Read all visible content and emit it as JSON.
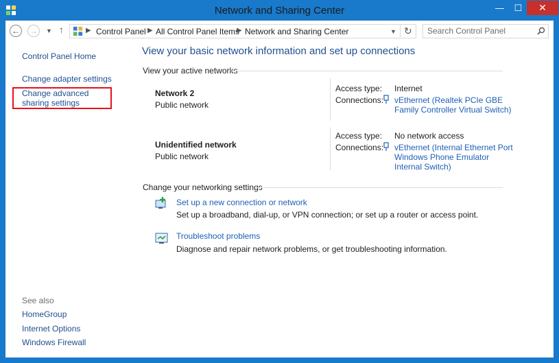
{
  "window": {
    "title": "Network and Sharing Center",
    "controls": {
      "minimize": "—",
      "maximize": "☐",
      "close": "✕"
    }
  },
  "toolbar": {
    "back_icon": "back-arrow-icon",
    "forward_icon": "forward-arrow-icon",
    "recent_icon": "chevron-down-icon",
    "up_icon": "up-arrow-icon",
    "breadcrumb": [
      "Control Panel",
      "All Control Panel Items",
      "Network and Sharing Center"
    ],
    "search_placeholder": "Search Control Panel"
  },
  "sidebar": {
    "home": "Control Panel Home",
    "items": [
      "Change adapter settings",
      "Change advanced sharing settings"
    ],
    "see_also_label": "See also",
    "see_also": [
      "HomeGroup",
      "Internet Options",
      "Windows Firewall"
    ]
  },
  "main": {
    "heading": "View your basic network information and set up connections",
    "active_label": "View your active networks",
    "networks": [
      {
        "name": "Network  2",
        "type": "Public network",
        "access_label": "Access type:",
        "access_value": "Internet",
        "connections_label": "Connections:",
        "connection_lines": [
          "vEthernet (Realtek PCIe GBE",
          "Family Controller Virtual Switch)"
        ]
      },
      {
        "name": "Unidentified network",
        "type": "Public network",
        "access_label": "Access type:",
        "access_value": "No network access",
        "connections_label": "Connections:",
        "connection_lines": [
          "vEthernet (Internal Ethernet Port",
          "Windows Phone Emulator",
          "Internal Switch)"
        ]
      }
    ],
    "settings_label": "Change your networking settings",
    "tasks": [
      {
        "link": "Set up a new connection or network",
        "desc": "Set up a broadband, dial-up, or VPN connection; or set up a router or access point."
      },
      {
        "link": "Troubleshoot problems",
        "desc": "Diagnose and repair network problems, or get troubleshooting information."
      }
    ]
  },
  "colors": {
    "accent": "#1979ca",
    "link": "#1f5fb5",
    "highlight": "#e3121c"
  }
}
